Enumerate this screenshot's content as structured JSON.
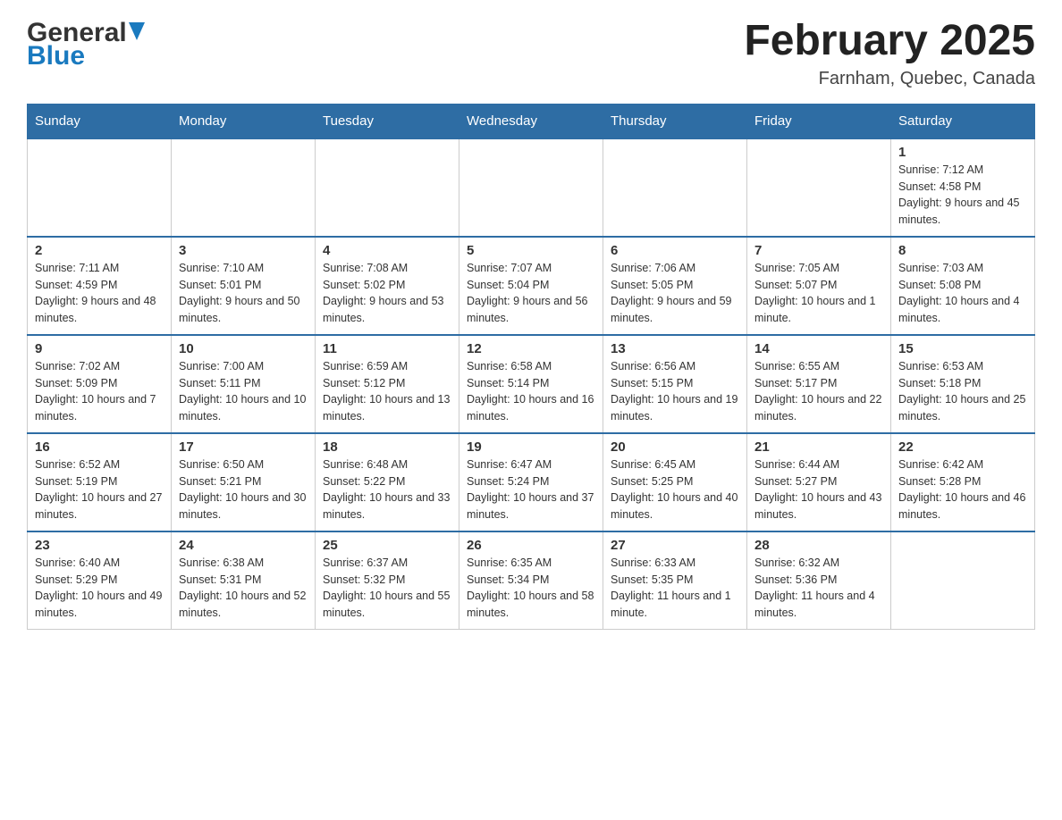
{
  "header": {
    "logo_general": "General",
    "logo_blue": "Blue",
    "month_title": "February 2025",
    "location": "Farnham, Quebec, Canada"
  },
  "days_of_week": [
    "Sunday",
    "Monday",
    "Tuesday",
    "Wednesday",
    "Thursday",
    "Friday",
    "Saturday"
  ],
  "weeks": [
    {
      "cells": [
        {
          "empty": true
        },
        {
          "empty": true
        },
        {
          "empty": true
        },
        {
          "empty": true
        },
        {
          "empty": true
        },
        {
          "empty": true
        },
        {
          "day": 1,
          "sunrise": "7:12 AM",
          "sunset": "4:58 PM",
          "daylight": "9 hours and 45 minutes"
        }
      ]
    },
    {
      "cells": [
        {
          "day": 2,
          "sunrise": "7:11 AM",
          "sunset": "4:59 PM",
          "daylight": "9 hours and 48 minutes"
        },
        {
          "day": 3,
          "sunrise": "7:10 AM",
          "sunset": "5:01 PM",
          "daylight": "9 hours and 50 minutes"
        },
        {
          "day": 4,
          "sunrise": "7:08 AM",
          "sunset": "5:02 PM",
          "daylight": "9 hours and 53 minutes"
        },
        {
          "day": 5,
          "sunrise": "7:07 AM",
          "sunset": "5:04 PM",
          "daylight": "9 hours and 56 minutes"
        },
        {
          "day": 6,
          "sunrise": "7:06 AM",
          "sunset": "5:05 PM",
          "daylight": "9 hours and 59 minutes"
        },
        {
          "day": 7,
          "sunrise": "7:05 AM",
          "sunset": "5:07 PM",
          "daylight": "10 hours and 1 minute"
        },
        {
          "day": 8,
          "sunrise": "7:03 AM",
          "sunset": "5:08 PM",
          "daylight": "10 hours and 4 minutes"
        }
      ]
    },
    {
      "cells": [
        {
          "day": 9,
          "sunrise": "7:02 AM",
          "sunset": "5:09 PM",
          "daylight": "10 hours and 7 minutes"
        },
        {
          "day": 10,
          "sunrise": "7:00 AM",
          "sunset": "5:11 PM",
          "daylight": "10 hours and 10 minutes"
        },
        {
          "day": 11,
          "sunrise": "6:59 AM",
          "sunset": "5:12 PM",
          "daylight": "10 hours and 13 minutes"
        },
        {
          "day": 12,
          "sunrise": "6:58 AM",
          "sunset": "5:14 PM",
          "daylight": "10 hours and 16 minutes"
        },
        {
          "day": 13,
          "sunrise": "6:56 AM",
          "sunset": "5:15 PM",
          "daylight": "10 hours and 19 minutes"
        },
        {
          "day": 14,
          "sunrise": "6:55 AM",
          "sunset": "5:17 PM",
          "daylight": "10 hours and 22 minutes"
        },
        {
          "day": 15,
          "sunrise": "6:53 AM",
          "sunset": "5:18 PM",
          "daylight": "10 hours and 25 minutes"
        }
      ]
    },
    {
      "cells": [
        {
          "day": 16,
          "sunrise": "6:52 AM",
          "sunset": "5:19 PM",
          "daylight": "10 hours and 27 minutes"
        },
        {
          "day": 17,
          "sunrise": "6:50 AM",
          "sunset": "5:21 PM",
          "daylight": "10 hours and 30 minutes"
        },
        {
          "day": 18,
          "sunrise": "6:48 AM",
          "sunset": "5:22 PM",
          "daylight": "10 hours and 33 minutes"
        },
        {
          "day": 19,
          "sunrise": "6:47 AM",
          "sunset": "5:24 PM",
          "daylight": "10 hours and 37 minutes"
        },
        {
          "day": 20,
          "sunrise": "6:45 AM",
          "sunset": "5:25 PM",
          "daylight": "10 hours and 40 minutes"
        },
        {
          "day": 21,
          "sunrise": "6:44 AM",
          "sunset": "5:27 PM",
          "daylight": "10 hours and 43 minutes"
        },
        {
          "day": 22,
          "sunrise": "6:42 AM",
          "sunset": "5:28 PM",
          "daylight": "10 hours and 46 minutes"
        }
      ]
    },
    {
      "cells": [
        {
          "day": 23,
          "sunrise": "6:40 AM",
          "sunset": "5:29 PM",
          "daylight": "10 hours and 49 minutes"
        },
        {
          "day": 24,
          "sunrise": "6:38 AM",
          "sunset": "5:31 PM",
          "daylight": "10 hours and 52 minutes"
        },
        {
          "day": 25,
          "sunrise": "6:37 AM",
          "sunset": "5:32 PM",
          "daylight": "10 hours and 55 minutes"
        },
        {
          "day": 26,
          "sunrise": "6:35 AM",
          "sunset": "5:34 PM",
          "daylight": "10 hours and 58 minutes"
        },
        {
          "day": 27,
          "sunrise": "6:33 AM",
          "sunset": "5:35 PM",
          "daylight": "11 hours and 1 minute"
        },
        {
          "day": 28,
          "sunrise": "6:32 AM",
          "sunset": "5:36 PM",
          "daylight": "11 hours and 4 minutes"
        },
        {
          "empty": true
        }
      ]
    }
  ],
  "labels": {
    "sunrise": "Sunrise:",
    "sunset": "Sunset:",
    "daylight": "Daylight:"
  }
}
